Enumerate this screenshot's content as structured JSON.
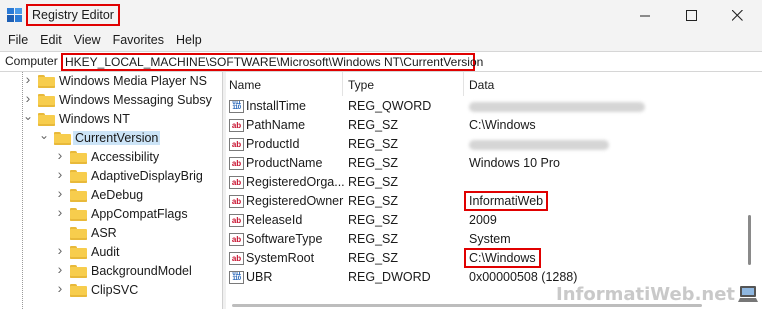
{
  "window": {
    "title": "Registry Editor"
  },
  "menu": [
    "File",
    "Edit",
    "View",
    "Favorites",
    "Help"
  ],
  "address": {
    "label": "Computer",
    "path": "HKEY_LOCAL_MACHINE\\SOFTWARE\\Microsoft\\Windows NT\\CurrentVersion"
  },
  "tree": [
    {
      "label": "Windows Media Player NS",
      "level": 1,
      "expander": "collapsed"
    },
    {
      "label": "Windows Messaging Subsy",
      "level": 1,
      "expander": "collapsed"
    },
    {
      "label": "Windows NT",
      "level": 1,
      "expander": "expanded"
    },
    {
      "label": "CurrentVersion",
      "level": 2,
      "expander": "expanded",
      "selected": true
    },
    {
      "label": "Accessibility",
      "level": 3,
      "expander": "collapsed"
    },
    {
      "label": "AdaptiveDisplayBrig",
      "level": 3,
      "expander": "collapsed"
    },
    {
      "label": "AeDebug",
      "level": 3,
      "expander": "collapsed"
    },
    {
      "label": "AppCompatFlags",
      "level": 3,
      "expander": "collapsed"
    },
    {
      "label": "ASR",
      "level": 3,
      "expander": "none"
    },
    {
      "label": "Audit",
      "level": 3,
      "expander": "collapsed"
    },
    {
      "label": "BackgroundModel",
      "level": 3,
      "expander": "collapsed"
    },
    {
      "label": "ClipSVC",
      "level": 3,
      "expander": "collapsed"
    }
  ],
  "columns": {
    "name": "Name",
    "type": "Type",
    "data": "Data"
  },
  "values": [
    {
      "name": "InstallTime",
      "type": "REG_QWORD",
      "data": "",
      "icon": "binary-value-icon",
      "redacted": true
    },
    {
      "name": "PathName",
      "type": "REG_SZ",
      "data": "C:\\Windows",
      "icon": "string-value-icon"
    },
    {
      "name": "ProductId",
      "type": "REG_SZ",
      "data": "",
      "icon": "string-value-icon",
      "redacted": true
    },
    {
      "name": "ProductName",
      "type": "REG_SZ",
      "data": "Windows 10 Pro",
      "icon": "string-value-icon"
    },
    {
      "name": "RegisteredOrga...",
      "type": "REG_SZ",
      "data": "",
      "icon": "string-value-icon"
    },
    {
      "name": "RegisteredOwner",
      "type": "REG_SZ",
      "data": "InformatiWeb",
      "icon": "string-value-icon",
      "highlight": true
    },
    {
      "name": "ReleaseId",
      "type": "REG_SZ",
      "data": "2009",
      "icon": "string-value-icon"
    },
    {
      "name": "SoftwareType",
      "type": "REG_SZ",
      "data": "System",
      "icon": "string-value-icon"
    },
    {
      "name": "SystemRoot",
      "type": "REG_SZ",
      "data": "C:\\Windows",
      "icon": "string-value-icon",
      "highlight": true
    },
    {
      "name": "UBR",
      "type": "REG_DWORD",
      "data": "0x00000508 (1288)",
      "icon": "binary-value-icon"
    }
  ],
  "watermark": "InformatiWeb.net",
  "colors": {
    "highlight_border": "#e00000",
    "selection": "#cce4f7",
    "folder": "#f7cd4d"
  }
}
